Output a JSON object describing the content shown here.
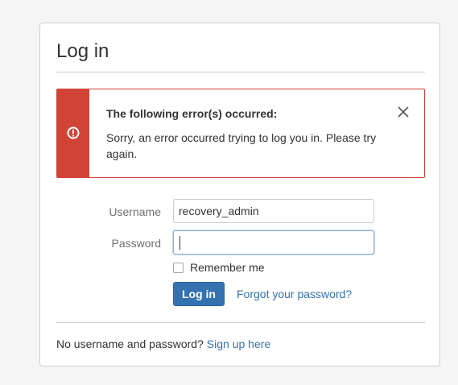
{
  "page": {
    "title": "Log in"
  },
  "error": {
    "heading": "The following error(s) occurred:",
    "message": "Sorry, an error occurred trying to log you in. Please try again.",
    "icon": "error-exclamation-icon",
    "close_icon": "close-icon",
    "accent_color": "#d04437"
  },
  "form": {
    "username_label": "Username",
    "username_value": "recovery_admin",
    "password_label": "Password",
    "password_value": "",
    "remember_label": "Remember me",
    "remember_checked": false,
    "login_label": "Log in",
    "forgot_label": "Forgot your password?"
  },
  "footer": {
    "prompt": "No username and password?",
    "signup_label": "Sign up here"
  },
  "colors": {
    "primary": "#3572b0",
    "error": "#d04437",
    "link": "#3572b0"
  }
}
